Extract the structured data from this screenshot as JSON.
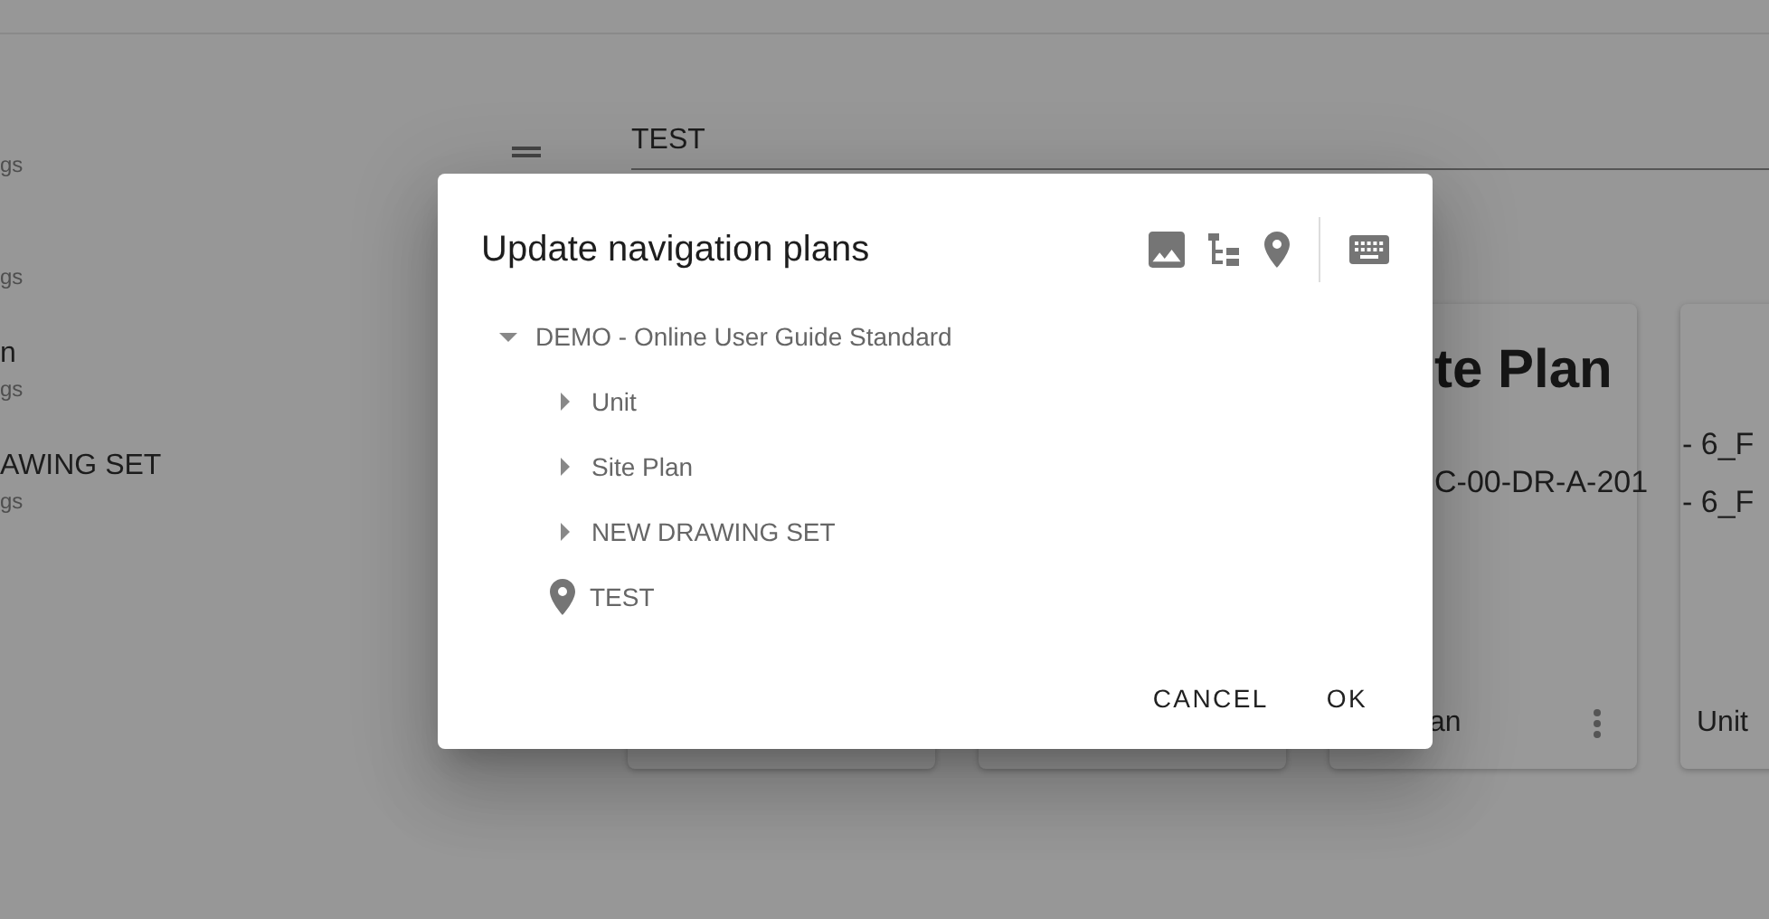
{
  "sidebar": {
    "items": [
      {
        "subtitle": "gs"
      },
      {
        "subtitle": "gs"
      },
      {
        "title": "n",
        "subtitle": "gs"
      },
      {
        "title": "AWING SET",
        "subtitle": "gs"
      }
    ]
  },
  "search": {
    "value": "TEST"
  },
  "cards": [
    {
      "title": "te Plan",
      "lines": [
        "C-00-DR-A-201"
      ],
      "footer": "an",
      "menu": true
    },
    {
      "lines": [
        "- 6_F",
        "- 6_F"
      ],
      "footer": "Unit"
    }
  ],
  "dialog": {
    "title": "Update navigation plans",
    "tree": [
      {
        "label": "DEMO - Online User Guide Standard",
        "kind": "folder",
        "expanded": true,
        "children": [
          {
            "label": "Unit",
            "kind": "folder",
            "expanded": false
          },
          {
            "label": "Site Plan",
            "kind": "folder",
            "expanded": false
          },
          {
            "label": "NEW DRAWING SET",
            "kind": "folder",
            "expanded": false
          },
          {
            "label": "TEST",
            "kind": "location"
          }
        ]
      }
    ],
    "buttons": [
      "CANCEL",
      "OK"
    ]
  }
}
